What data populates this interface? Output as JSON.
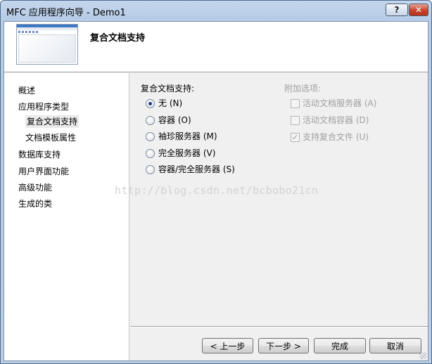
{
  "window": {
    "title": "MFC 应用程序向导 - Demo1",
    "help_label": "?",
    "close_label": "✕"
  },
  "header": {
    "title": "复合文档支持"
  },
  "nav": {
    "items": [
      {
        "label": "概述"
      },
      {
        "label": "应用程序类型"
      },
      {
        "label": "复合文档支持"
      },
      {
        "label": "文档模板属性"
      },
      {
        "label": "数据库支持"
      },
      {
        "label": "用户界面功能"
      },
      {
        "label": "高级功能"
      },
      {
        "label": "生成的类"
      }
    ]
  },
  "compound": {
    "group_label": "复合文档支持:",
    "options": [
      {
        "label": "无 (N)",
        "selected": true
      },
      {
        "label": "容器 (O)",
        "selected": false
      },
      {
        "label": "袖珍服务器 (M)",
        "selected": false
      },
      {
        "label": "完全服务器 (V)",
        "selected": false
      },
      {
        "label": "容器/完全服务器 (S)",
        "selected": false
      }
    ]
  },
  "additional": {
    "group_label": "附加选项:",
    "options": [
      {
        "label": "活动文档服务器 (A)",
        "checked": false,
        "enabled": false
      },
      {
        "label": "活动文档容器 (D)",
        "checked": false,
        "enabled": false
      },
      {
        "label": "支持复合文件 (U)",
        "checked": true,
        "enabled": false
      }
    ]
  },
  "watermark": "http://blog.csdn.net/bcbobo21cn",
  "buttons": {
    "prev": "< 上一步",
    "next": "下一步 >",
    "finish": "完成",
    "cancel": "取消"
  },
  "icons": {
    "radio_selected": "radio-selected-icon",
    "checkmark": "checkmark-icon"
  }
}
